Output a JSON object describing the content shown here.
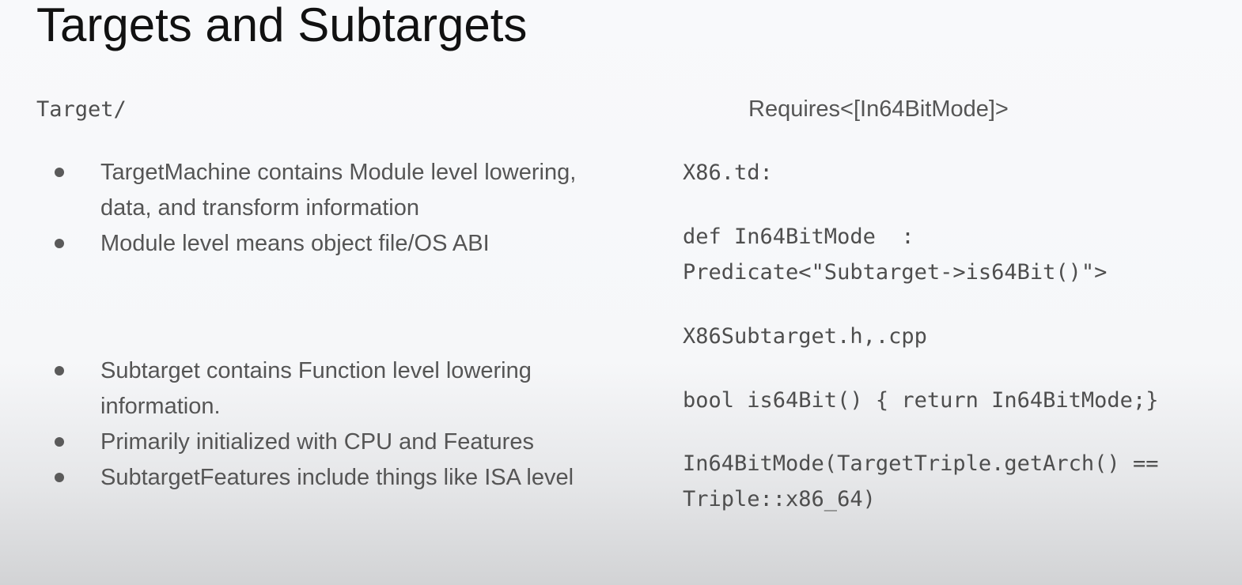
{
  "slide": {
    "title": "Targets and Subtargets",
    "left": {
      "heading": "Target/",
      "group1": [
        "TargetMachine contains Module level lowering, data, and transform information",
        "Module level means object file/OS ABI"
      ],
      "group2": [
        "Subtarget contains Function level lowering information.",
        "Primarily initialized with CPU and Features",
        "SubtargetFeatures include things like ISA level"
      ]
    },
    "right": {
      "requires": "Requires<[In64BitMode]>",
      "code_blocks": [
        "X86.td:",
        "def In64BitMode  :\nPredicate<\"Subtarget->is64Bit()\">",
        "X86Subtarget.h,.cpp",
        "bool is64Bit() { return In64BitMode;}",
        "In64BitMode(TargetTriple.getArch() ==\nTriple::x86_64)"
      ]
    }
  }
}
